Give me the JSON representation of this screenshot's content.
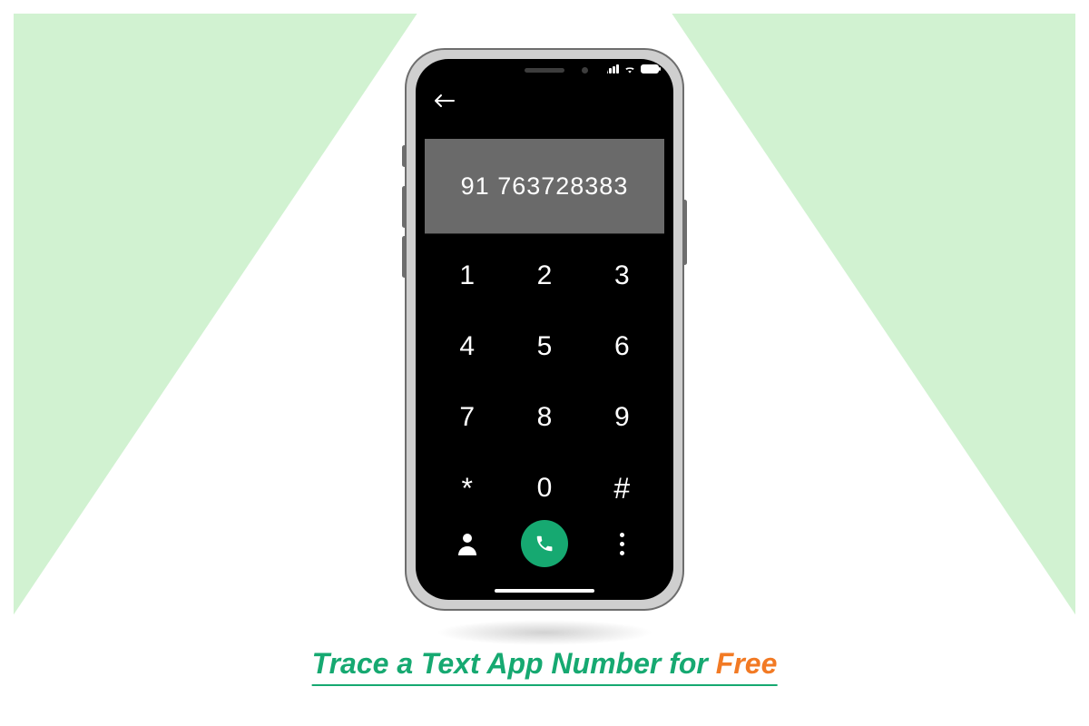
{
  "dialer": {
    "entered_number": "91 763728383",
    "keys": [
      "1",
      "2",
      "3",
      "4",
      "5",
      "6",
      "7",
      "8",
      "9",
      "*",
      "0",
      "#"
    ]
  },
  "icons": {
    "back": "back-arrow-icon",
    "signal": "signal-icon",
    "wifi": "wifi-icon",
    "battery": "battery-icon",
    "contacts": "person-icon",
    "call": "phone-icon",
    "more": "more-vertical-icon"
  },
  "caption": {
    "main": "Trace a Text App Number for ",
    "accent": "Free"
  },
  "colors": {
    "green_bg": "#d1f2d1",
    "brand_green": "#16a971",
    "accent_orange": "#f27a24",
    "display_bg": "#6a6a6a"
  }
}
